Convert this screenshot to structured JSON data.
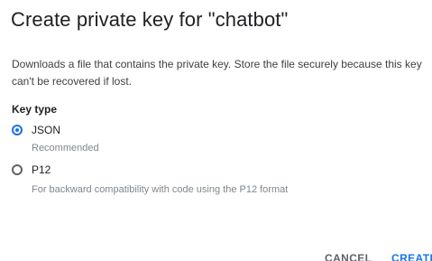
{
  "dialog": {
    "title": "Create private key for \"chatbot\"",
    "description": "Downloads a file that contains the private key. Store the file securely because this key can't be recovered if lost.",
    "key_type_label": "Key type",
    "options": [
      {
        "label": "JSON",
        "hint": "Recommended",
        "selected": true
      },
      {
        "label": "P12",
        "hint": "For backward compatibility with code using the P12 format",
        "selected": false
      }
    ],
    "buttons": {
      "cancel": "CANCEL",
      "create": "CREATE"
    }
  },
  "colors": {
    "accent": "#1a73e8",
    "text": "#202124",
    "muted": "#80868b"
  }
}
